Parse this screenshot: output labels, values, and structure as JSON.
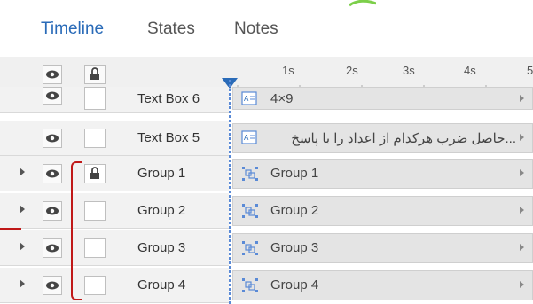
{
  "tabs": {
    "timeline": "Timeline",
    "states": "States",
    "notes": "Notes"
  },
  "ruler": {
    "ticks": [
      "1s",
      "2s",
      "3s",
      "4s",
      "5"
    ]
  },
  "rows": [
    {
      "name": "Text Box 6",
      "bar_label": "4×9",
      "expandable": false,
      "locked": false,
      "icon": "text-box-icon"
    },
    {
      "name": "Text Box 5",
      "bar_label": "...حاصل ضرب هرکدام از اعداد را با پاسخ",
      "expandable": false,
      "locked": false,
      "icon": "text-box-icon"
    },
    {
      "name": "Group 1",
      "bar_label": "Group  1",
      "expandable": true,
      "locked": true,
      "icon": "group-icon"
    },
    {
      "name": "Group 2",
      "bar_label": "Group  2",
      "expandable": true,
      "locked": false,
      "icon": "group-icon"
    },
    {
      "name": "Group 3",
      "bar_label": "Group  3",
      "expandable": true,
      "locked": false,
      "icon": "group-icon"
    },
    {
      "name": "Group 4",
      "bar_label": "Group  4",
      "expandable": true,
      "locked": false,
      "icon": "group-icon"
    }
  ],
  "colors": {
    "accent": "#2a6bb8",
    "annotation": "#c01818",
    "playhead": "#5a8ad6"
  }
}
